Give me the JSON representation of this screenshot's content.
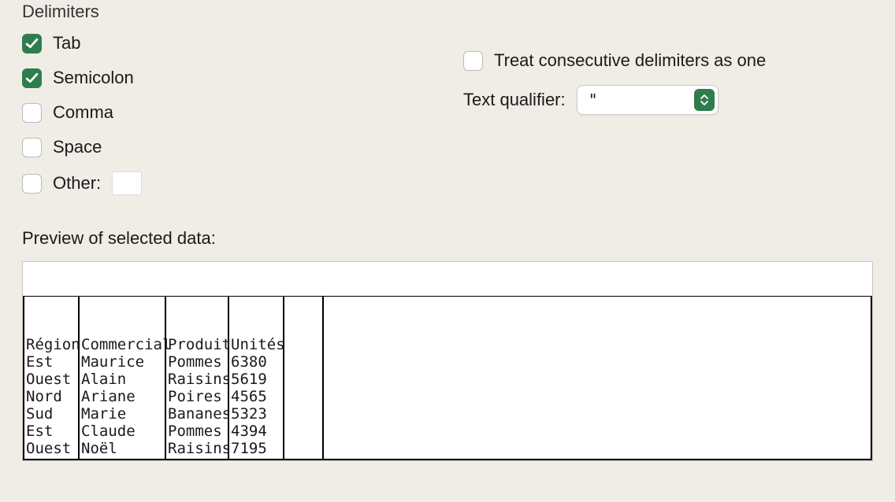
{
  "delimiters": {
    "title": "Delimiters",
    "options": [
      {
        "key": "tab",
        "label": "Tab",
        "checked": true
      },
      {
        "key": "semicolon",
        "label": "Semicolon",
        "checked": true
      },
      {
        "key": "comma",
        "label": "Comma",
        "checked": false
      },
      {
        "key": "space",
        "label": "Space",
        "checked": false
      },
      {
        "key": "other",
        "label": "Other:",
        "checked": false
      }
    ],
    "other_value": ""
  },
  "consecutive": {
    "label": "Treat consecutive delimiters as one",
    "checked": false
  },
  "text_qualifier": {
    "label": "Text qualifier:",
    "value": "\""
  },
  "preview": {
    "title": "Preview of selected data:",
    "columns": [
      "Région",
      "Commercial",
      "Produit",
      "Unités"
    ],
    "rows": [
      [
        "Est",
        "Maurice",
        "Pommes",
        "6380"
      ],
      [
        "Ouest",
        "Alain",
        "Raisins",
        "5619"
      ],
      [
        "Nord",
        "Ariane",
        "Poires",
        "4565"
      ],
      [
        "Sud",
        "Marie",
        "Bananes",
        "5323"
      ],
      [
        "Est",
        "Claude",
        "Pommes",
        "4394"
      ],
      [
        "Ouest",
        "Noël",
        "Raisins",
        "7195"
      ]
    ]
  }
}
